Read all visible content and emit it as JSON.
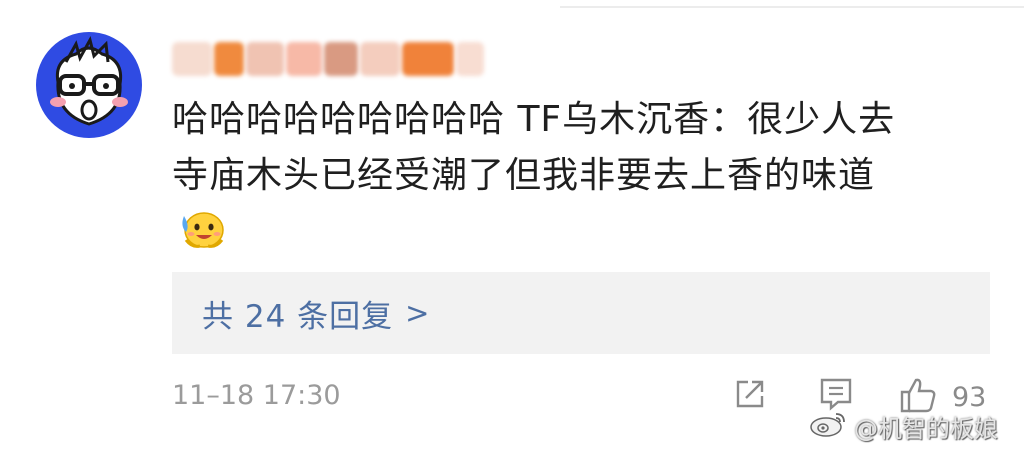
{
  "comment": {
    "text_line1": "哈哈哈哈哈哈哈哈哈 TF乌木沉香：很少人去",
    "text_line2": "寺庙木头已经受潮了但我非要去上香的味道",
    "sticker_icon": "sweat-smile-emoji"
  },
  "reply": {
    "label": "共 24 条回复",
    "chevron": ">"
  },
  "meta": {
    "timestamp": "11–18 17:30",
    "like_count": "93"
  },
  "actions": [
    "share-icon",
    "comment-icon",
    "thumbs-up-icon"
  ],
  "watermark": {
    "logo_icon": "weibo-logo",
    "text": "@机智的板娘"
  },
  "colors": {
    "avatar_bg": "#2f4be3",
    "reply_link": "#4d6fa3",
    "reply_bg": "#f2f2f2",
    "meta_text": "#9b9b9b"
  }
}
